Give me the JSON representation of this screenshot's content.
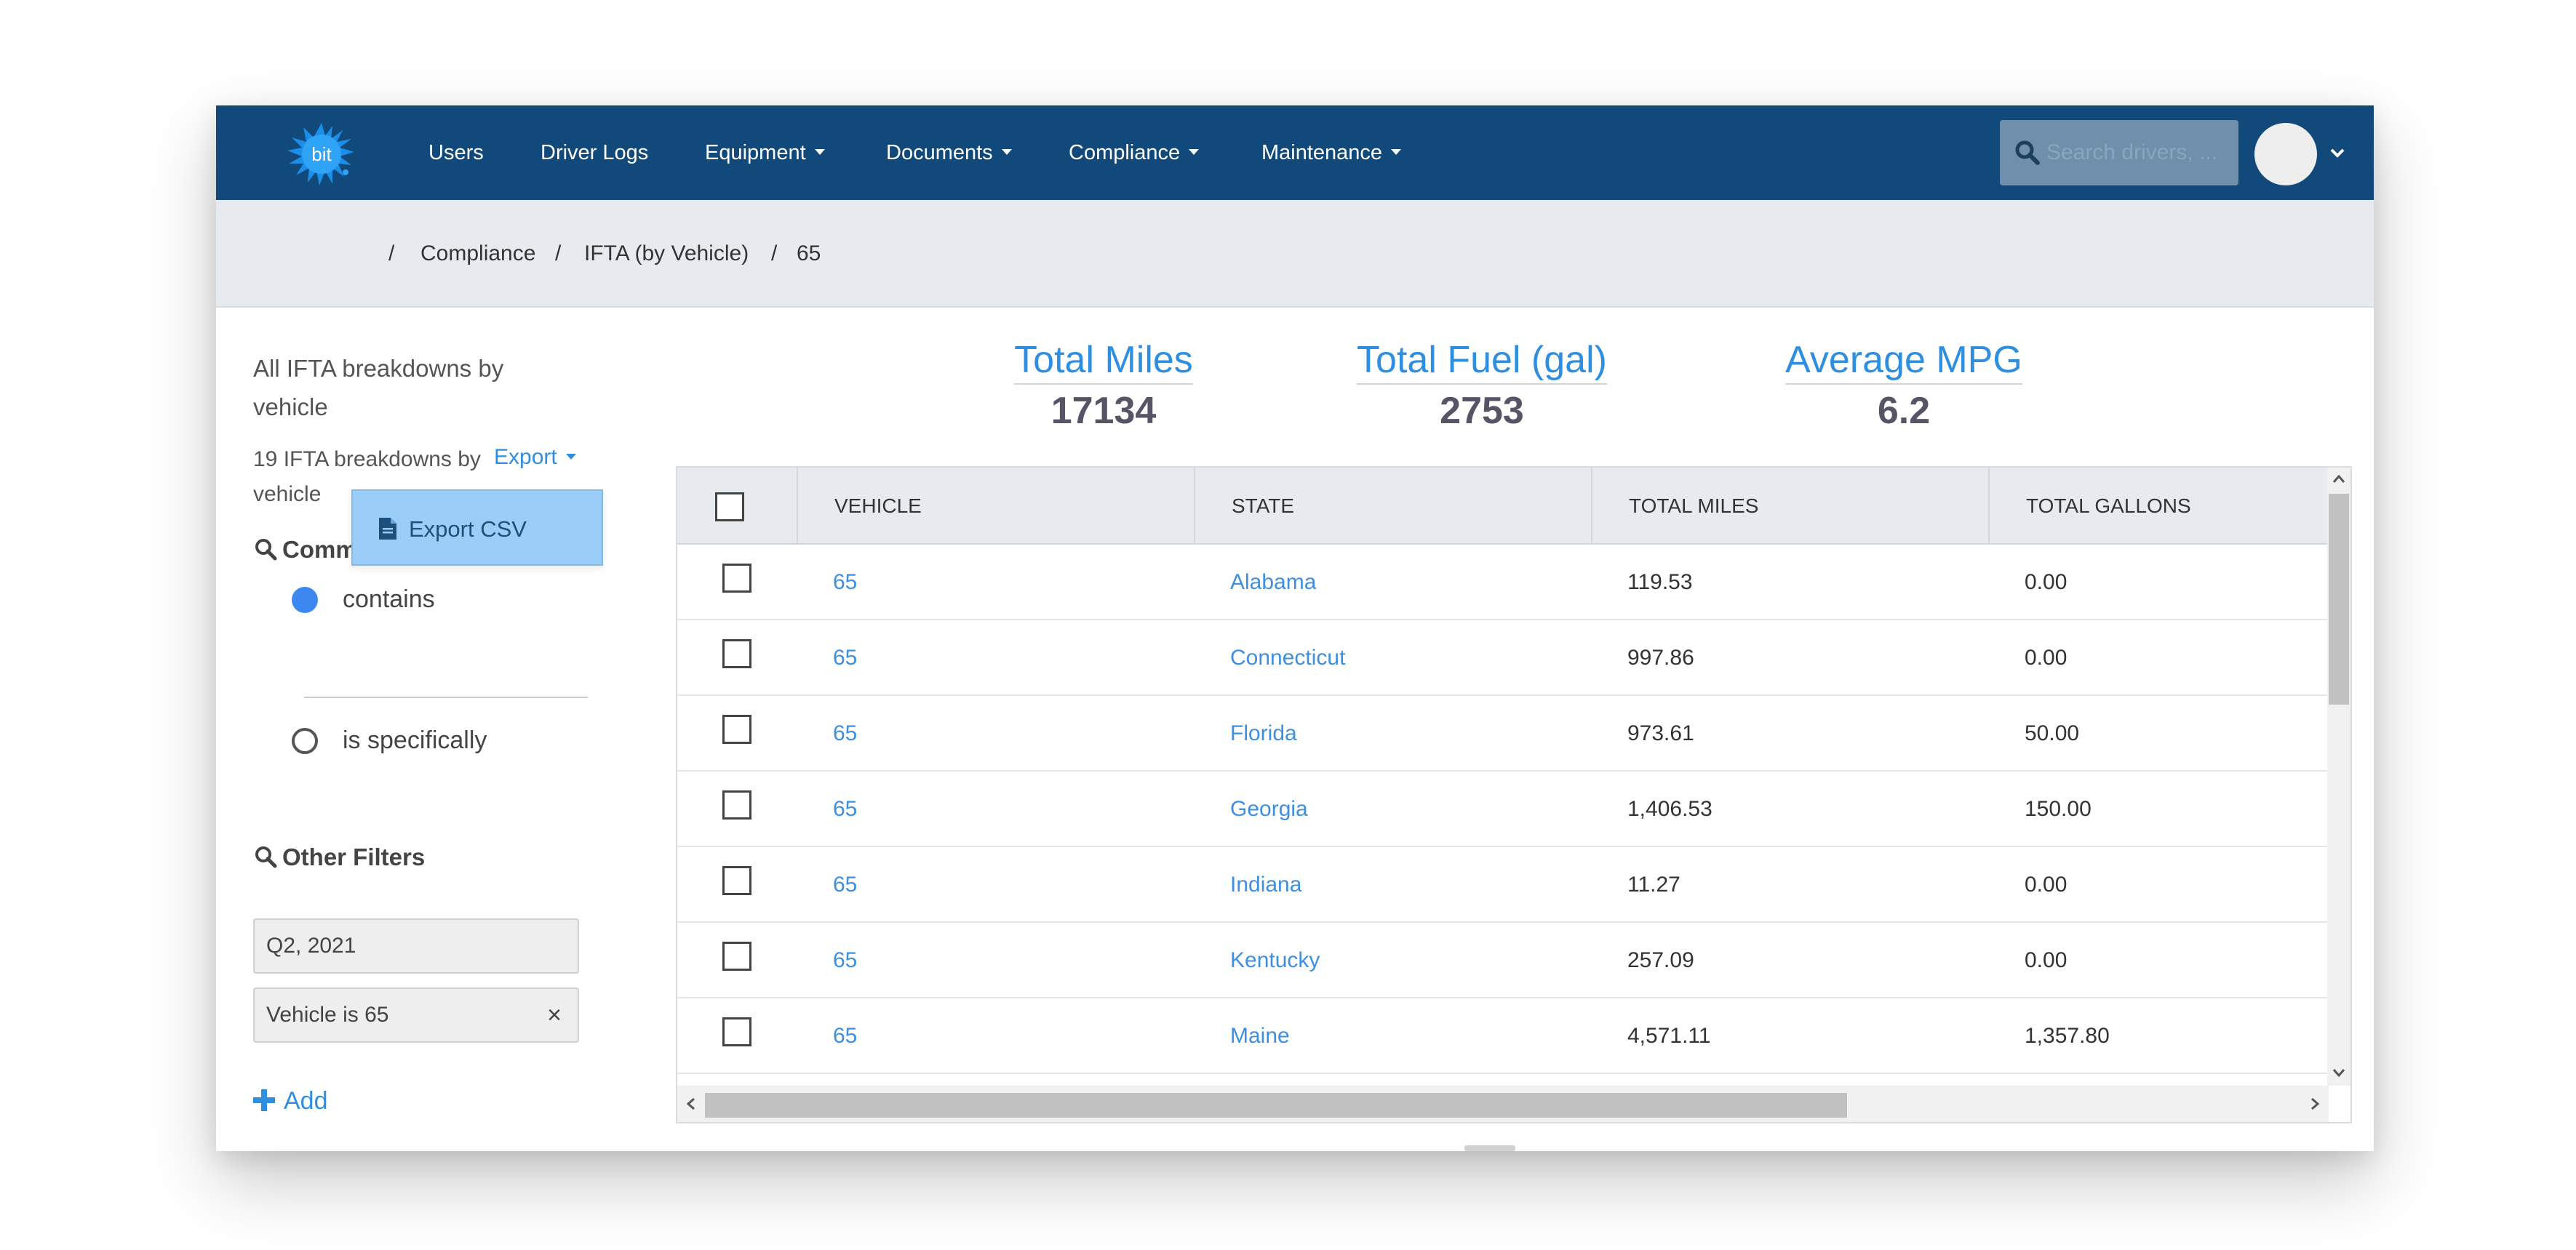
{
  "navbar": {
    "logo_text": "bit",
    "items": [
      {
        "label": "Users"
      },
      {
        "label": "Driver Logs"
      },
      {
        "label": "Equipment"
      },
      {
        "label": "Documents"
      },
      {
        "label": "Compliance"
      },
      {
        "label": "Maintenance"
      }
    ],
    "search_placeholder": "Search drivers, ..."
  },
  "breadcrumb": {
    "separator": "/",
    "items": [
      "Compliance",
      "IFTA (by Vehicle)",
      "65"
    ]
  },
  "sidebar": {
    "title": "All IFTA breakdowns by vehicle",
    "count_text": "19 IFTA breakdowns by vehicle",
    "export_label": "Export",
    "export_menu_item": "Export CSV",
    "common_heading": "Comm",
    "radio_contains": "contains",
    "radio_specifically": "is specifically",
    "other_filters_heading": "Other Filters",
    "filter_period": "Q2, 2021",
    "filter_vehicle": "Vehicle is 65",
    "remove_symbol": "×",
    "add_label": "Add"
  },
  "stats": {
    "total_miles_label": "Total Miles",
    "total_miles_value": "17134",
    "total_fuel_label": "Total Fuel (gal)",
    "total_fuel_value": "2753",
    "avg_mpg_label": "Average MPG",
    "avg_mpg_value": "6.2"
  },
  "table": {
    "columns": [
      "VEHICLE",
      "STATE",
      "TOTAL MILES",
      "TOTAL GALLONS"
    ],
    "rows": [
      {
        "vehicle": "65",
        "state": "Alabama",
        "miles": "119.53",
        "gallons": "0.00"
      },
      {
        "vehicle": "65",
        "state": "Connecticut",
        "miles": "997.86",
        "gallons": "0.00"
      },
      {
        "vehicle": "65",
        "state": "Florida",
        "miles": "973.61",
        "gallons": "50.00"
      },
      {
        "vehicle": "65",
        "state": "Georgia",
        "miles": "1,406.53",
        "gallons": "150.00"
      },
      {
        "vehicle": "65",
        "state": "Indiana",
        "miles": "11.27",
        "gallons": "0.00"
      },
      {
        "vehicle": "65",
        "state": "Kentucky",
        "miles": "257.09",
        "gallons": "0.00"
      },
      {
        "vehicle": "65",
        "state": "Maine",
        "miles": "4,571.11",
        "gallons": "1,357.80"
      }
    ]
  },
  "colors": {
    "navbar": "#114a7a",
    "accent": "#2e8fe0",
    "radio_selected": "#3d87f0",
    "export_menu": "#9acdf7"
  }
}
